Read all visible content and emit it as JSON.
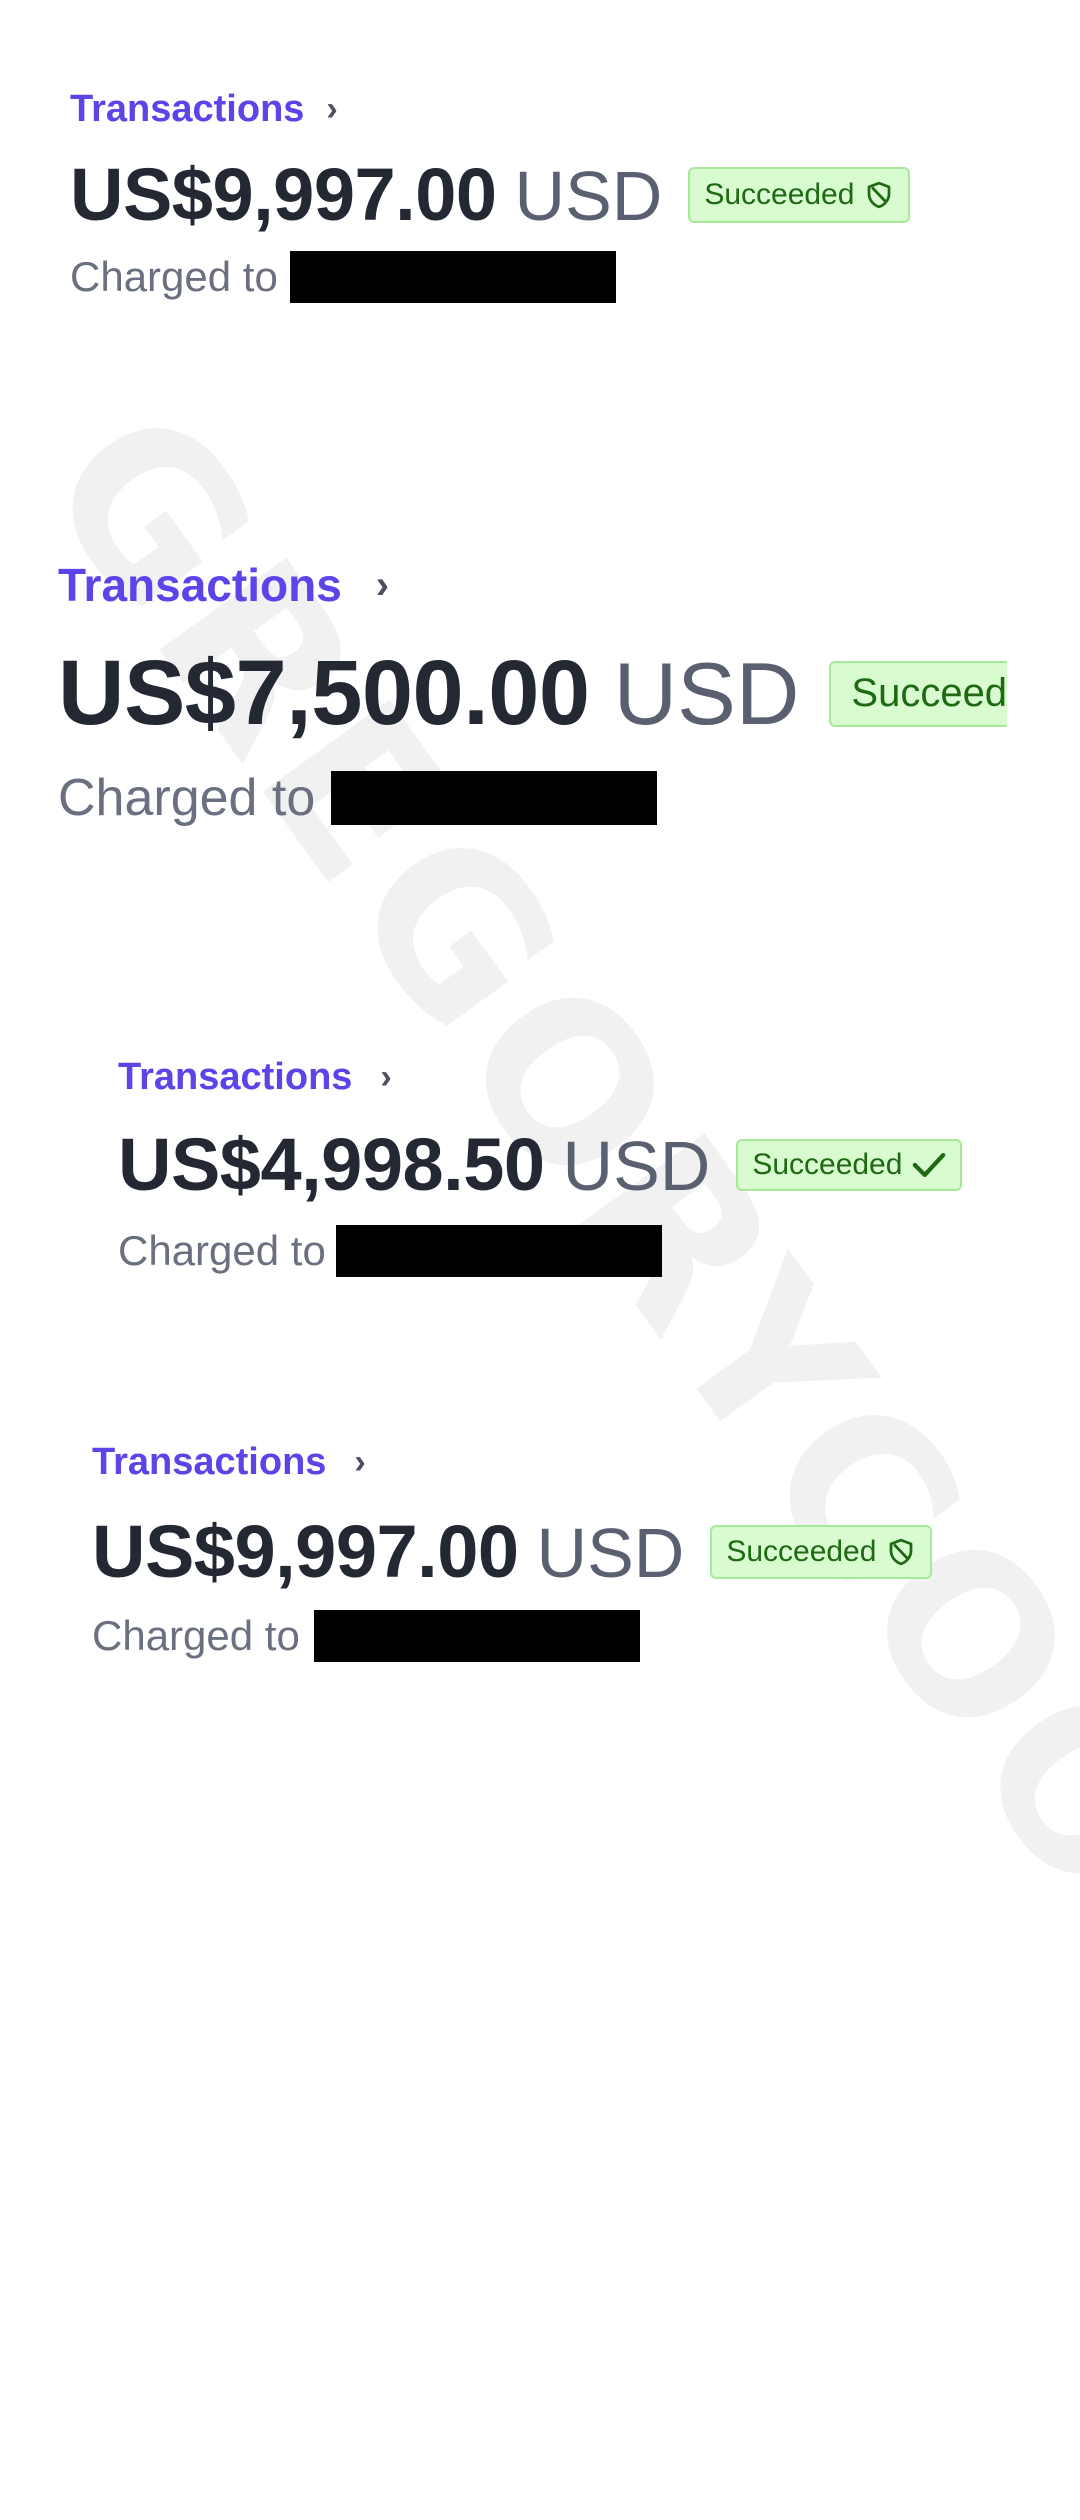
{
  "watermark": "GREGORYCOOKE.IO",
  "colors": {
    "link": "#5b45e8",
    "amount": "#232833",
    "badge_bg": "#d9fbd0",
    "badge_border": "#a8e89a",
    "badge_text": "#1d6a12",
    "redaction": "#000000"
  },
  "transactions": [
    {
      "breadcrumb": "Transactions",
      "amount": "US$9,997.00",
      "currency": "USD",
      "status": "Succeeded",
      "status_icon": "shield-icon",
      "charged_label": "Charged to"
    },
    {
      "breadcrumb": "Transactions",
      "amount": "US$7,500.00",
      "currency": "USD",
      "status": "Succeed",
      "status_icon": "",
      "charged_label": "Charged to"
    },
    {
      "breadcrumb": "Transactions",
      "amount": "US$4,998.50",
      "currency": "USD",
      "status": "Succeeded",
      "status_icon": "checkmark-icon",
      "charged_label": "Charged to"
    },
    {
      "breadcrumb": "Transactions",
      "amount": "US$9,997.00",
      "currency": "USD",
      "status": "Succeeded",
      "status_icon": "shield-icon",
      "charged_label": "Charged to"
    }
  ]
}
